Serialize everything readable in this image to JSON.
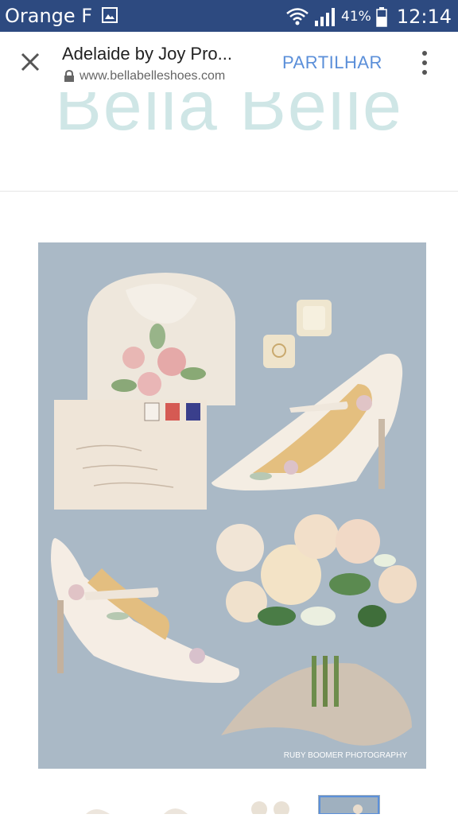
{
  "status_bar": {
    "carrier": "Orange F",
    "battery": "41%",
    "time": "12:14",
    "icons": [
      "image-icon",
      "wifi-icon",
      "signal-icon",
      "battery-icon"
    ]
  },
  "toolbar": {
    "title": "Adelaide by Joy Pro...",
    "url": "www.bellabelleshoes.com",
    "share_label": "PARTILHAR",
    "icons": [
      "close-icon",
      "lock-icon",
      "more-vert-icon"
    ]
  },
  "page": {
    "logo": "Bella Belle",
    "image_credit": "RUBY BOOMER PHOTOGRAPHY"
  },
  "colors": {
    "status_bar": "#2d4a80",
    "accent": "#5b8fd9",
    "logo": "#cfe6e6",
    "photo_background": "#aab9c6"
  }
}
